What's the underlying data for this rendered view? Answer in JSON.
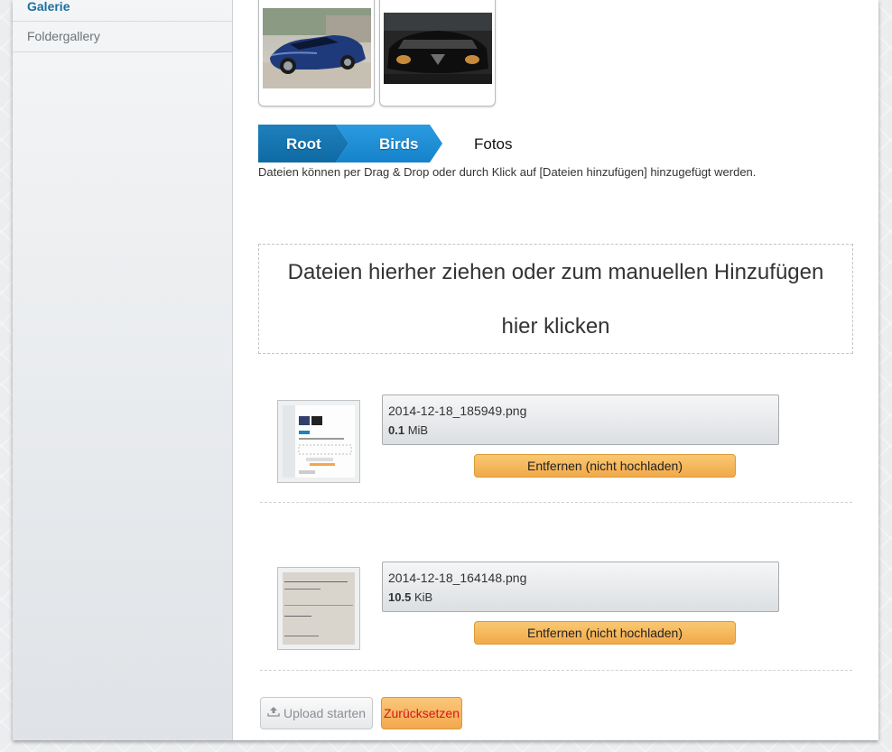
{
  "sidebar": {
    "items": [
      {
        "label": "Galerie",
        "active": true
      },
      {
        "label": "Foldergallery",
        "active": false
      }
    ]
  },
  "gallery_thumbs": [
    {
      "alt": "blue convertible car"
    },
    {
      "alt": "black car front"
    }
  ],
  "breadcrumb": {
    "items": [
      "Root",
      "Birds"
    ],
    "current": "Fotos"
  },
  "info_text": "Dateien können per Drag & Drop oder durch Klick auf [Dateien hinzufügen] hinzugefügt werden.",
  "dropzone": {
    "line1": "Dateien hierher ziehen oder zum manuellen Hinzufügen",
    "line2": "hier klicken"
  },
  "files": [
    {
      "name": "2014-12-18_185949.png",
      "size_value": "0.1",
      "size_unit": "MiB",
      "remove_label": "Entfernen (nicht hochladen)"
    },
    {
      "name": "2014-12-18_164148.png",
      "size_value": "10.5",
      "size_unit": "KiB",
      "remove_label": "Entfernen (nicht hochladen)"
    }
  ],
  "actions": {
    "upload_label": "Upload starten",
    "reset_label": "Zurücksetzen"
  },
  "colors": {
    "accent": "#1a6fa0",
    "crumb_root": "#1276b3",
    "crumb_birds": "#2393d8",
    "remove_button": "#f4b45c",
    "reset_text": "#d3171a"
  }
}
